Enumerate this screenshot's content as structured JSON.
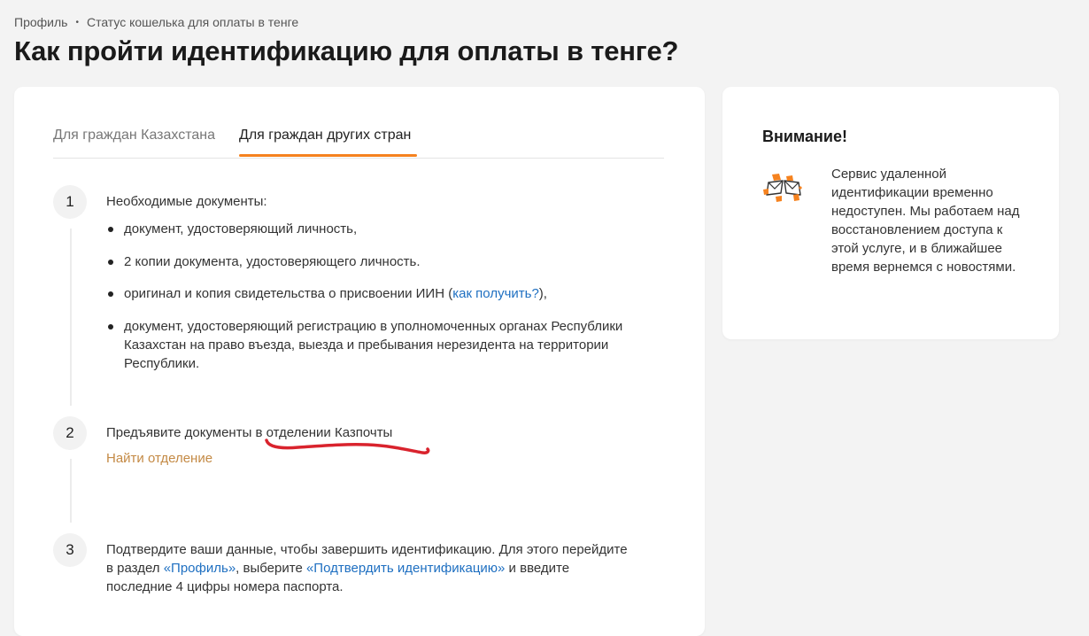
{
  "breadcrumb": {
    "items": [
      "Профиль",
      "Статус кошелька для оплаты в тенге"
    ],
    "separator": "•"
  },
  "page_title": "Как пройти идентификацию для оплаты в тенге?",
  "tabs": [
    {
      "label": "Для граждан Казахстана",
      "active": false
    },
    {
      "label": "Для граждан других стран",
      "active": true
    }
  ],
  "steps": [
    {
      "number": "1",
      "title": "Необходимые документы:",
      "bullets": [
        {
          "text": "документ, удостоверяющий личность,"
        },
        {
          "text": "2 копии документа, удостоверяющего личность."
        },
        {
          "text_before": "оригинал и копия свидетельства о присвоении ИИН (",
          "link": "как получить?",
          "text_after": "),"
        },
        {
          "text": "документ, удостоверяющий регистрацию в уполномоченных органах Республики Казахстан на право въезда, выезда и пребывания нерезидента на территории Республики."
        }
      ]
    },
    {
      "number": "2",
      "title": "Предъявите документы в отделении Казпочты",
      "link": "Найти отделение"
    },
    {
      "number": "3",
      "text_1": "Подтвердите ваши данные, чтобы завершить идентификацию. Для этого перейдите в раздел ",
      "link_1": "«Профиль»",
      "text_2": ", выберите ",
      "link_2": "«Подтвердить идентификацию»",
      "text_3": " и введите последние 4 цифры номера паспорта."
    }
  ],
  "notice": {
    "title": "Внимание!",
    "icon": "broken-envelope-icon",
    "text": "Сервис удаленной идентификации временно недоступен. Мы работаем над восстановлением доступа к этой услуге, и в ближайшее время вернемся с новостями."
  },
  "colors": {
    "accent": "#f5821f",
    "link": "#1e6fc1",
    "link_secondary": "#c48a45",
    "annotation": "#d9232d",
    "background": "#f3f3f3"
  }
}
